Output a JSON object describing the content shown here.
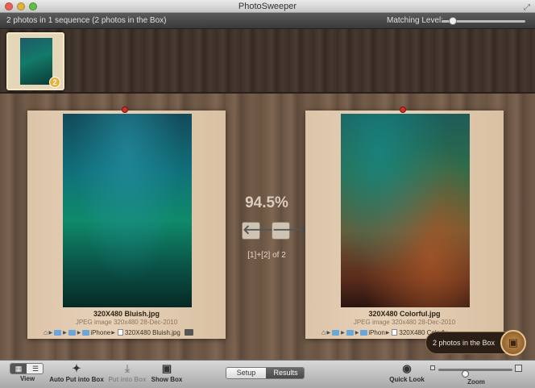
{
  "window": {
    "title": "PhotoSweeper"
  },
  "infobar": {
    "summary": "2 photos in 1 sequence (2 photos in the Box)",
    "matching_label": "Matching Level:",
    "matching_level": 0.1
  },
  "filmstrip": {
    "badge_count": "2"
  },
  "left_photo": {
    "filename": "320X480 Bluish.jpg",
    "meta": "JPEG image   320x480   28-Dec-2010",
    "path_folder": "iPhone",
    "path_file": "320X480 Bluish.jpg"
  },
  "right_photo": {
    "filename": "320X480 Colorful.jpg",
    "meta": "JPEG image   320x480   28-Dec-2010",
    "path_folder": "iPhon",
    "path_file": "320X480 Colorfu"
  },
  "comparison": {
    "similarity": "94.5%",
    "pager": "[1]+[2] of 2",
    "prev_glyph": "🡐",
    "next_glyph": "🡒"
  },
  "box_tip": {
    "text": "2 photos in the Box"
  },
  "toolbar": {
    "view_label": "View",
    "auto_put_label": "Auto Put into Box",
    "put_label": "Put into Box",
    "show_box_label": "Show Box",
    "setup_label": "Setup",
    "results_label": "Results",
    "quick_look_label": "Quick Look",
    "zoom_label": "Zoom",
    "zoom_level": 0.35
  },
  "icons": [
    "wand-icon",
    "download-icon",
    "box-icon",
    "eye-icon",
    "grid-icon",
    "list-icon",
    "home-icon",
    "folder-icon",
    "file-icon"
  ]
}
